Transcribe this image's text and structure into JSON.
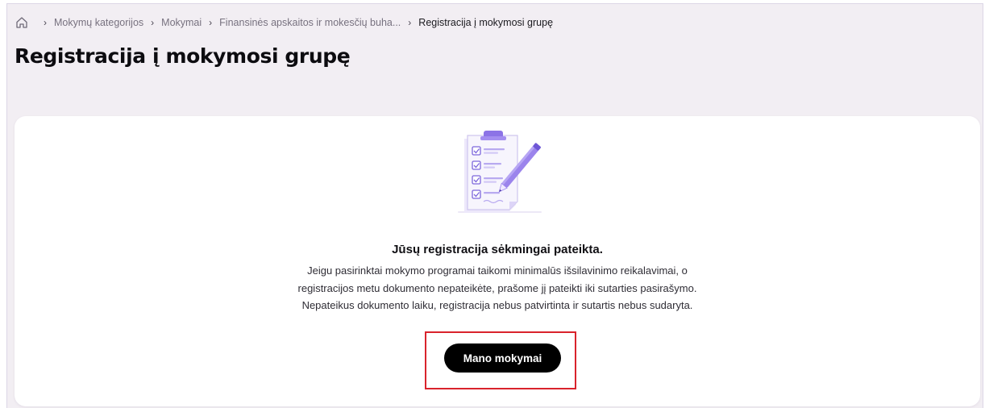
{
  "breadcrumb": {
    "items": [
      {
        "label": "Mokymų kategorijos"
      },
      {
        "label": "Mokymai"
      },
      {
        "label": "Finansinės apskaitos ir mokesčių buha..."
      }
    ],
    "current": "Registracija į mokymosi grupę",
    "separator": "›"
  },
  "page": {
    "title": "Registracija į mokymosi grupę"
  },
  "message": {
    "title": "Jūsų registracija sėkmingai pateikta.",
    "lines": [
      "Jeigu pasirinktai mokymo programai taikomi minimalūs išsilavinimo reikalavimai, o",
      "registracijos metu dokumento nepateikėte, prašome jį pateikti iki sutarties pasirašymo.",
      "Nepateikus dokumento laiku, registracija nebus patvirtinta ir sutartis nebus sudaryta."
    ]
  },
  "actions": {
    "primary_label": "Mano mokymai"
  },
  "icons": {
    "home": "home-icon",
    "illustration": "clipboard-checklist-icon"
  },
  "colors": {
    "background": "#f2eef3",
    "accent": "#a48ef0",
    "button": "#000000",
    "highlight": "#d9232c"
  }
}
